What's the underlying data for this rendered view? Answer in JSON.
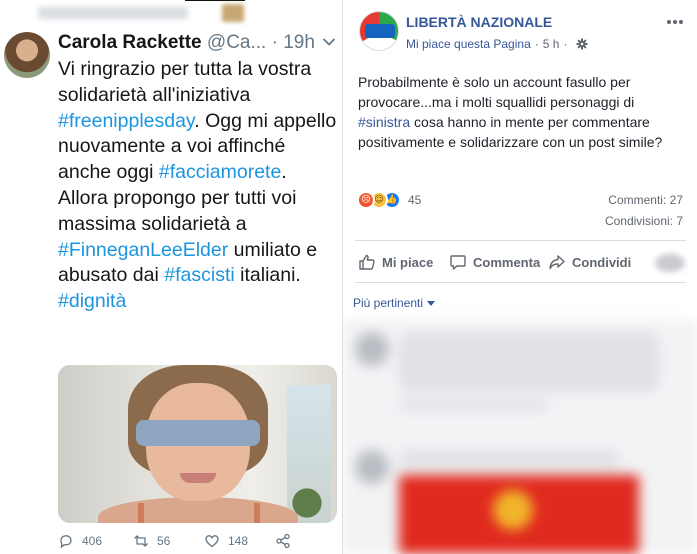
{
  "tweet": {
    "name": "Carola Rackette",
    "handle": "@Ca...",
    "separator": "·",
    "time": "19h",
    "text_segments": [
      {
        "text": "Vi ringrazio per tutta la vostra solidarietà all'iniziativa ",
        "hashtag": false
      },
      {
        "text": "#freenipplesday",
        "hashtag": true
      },
      {
        "text": ". Ogg mi appello nuovamente a voi affinché anche oggi ",
        "hashtag": false
      },
      {
        "text": "#facciamorete",
        "hashtag": true
      },
      {
        "text": ". Allora propongo per tutti voi massima solidarietà a ",
        "hashtag": false
      },
      {
        "text": "#FinneganLeeElder",
        "hashtag": true
      },
      {
        "text": " umiliato e abusato dai ",
        "hashtag": false
      },
      {
        "text": "#fascisti",
        "hashtag": true
      },
      {
        "text": " italiani. ",
        "hashtag": false
      },
      {
        "text": "#dignità",
        "hashtag": true
      }
    ],
    "replies": "406",
    "retweets": "56",
    "likes": "148",
    "colors": {
      "hashtag": "#1b95e0",
      "text": "#14171a",
      "muted": "#657786"
    }
  },
  "facebook": {
    "page_name": "LIBERTÀ NAZIONALE",
    "like_page": "Mi piace questa Pagina",
    "separator": "·",
    "time": "5 h",
    "text_segments": [
      {
        "text": "Probabilmente è solo un account fasullo per provocare...ma i molti squallidi personaggi di ",
        "hashtag": false
      },
      {
        "text": "#sinistra",
        "hashtag": true
      },
      {
        "text": " cosa hanno in mente per commentare positivamente e solidarizzare con un post simile?",
        "hashtag": false
      }
    ],
    "reactions": {
      "icons": [
        "angry-icon",
        "haha-icon",
        "like-icon"
      ],
      "count": "45"
    },
    "comments_count": "Commenti: 27",
    "shares_count": "Condivisioni: 7",
    "actions": {
      "like": "Mi piace",
      "comment": "Commenta",
      "share": "Condividi"
    },
    "sort_label": "Più pertinenti",
    "colors": {
      "link": "#365899",
      "text": "#1d2129",
      "muted": "#616770"
    }
  }
}
